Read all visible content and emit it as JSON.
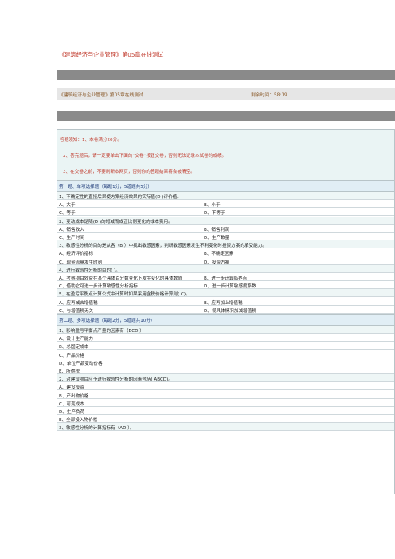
{
  "page_title": "《建筑经济与企业管理》第05章在线测试",
  "info": {
    "exam_name": "《建筑经济与企业管理》第05章在线测试",
    "timer": "剩余时间：58:19"
  },
  "notice": [
    "答题须知：1、本卷满分20分。",
    "2、答完题后，请一定要单击下面的“交卷”按钮交卷，否则无法记录本试卷的成绩。",
    "3、在交卷之前，不要刷新本网页，否则你的答题结果将会被清空。"
  ],
  "section1": {
    "heading": "第一题、单项选择题（每题1分，5道题共5分）",
    "questions": [
      {
        "stem": "1、不确定性的直接后果使方案经济效果的实际值(D )评价值。",
        "options": [
          [
            "A、大于",
            "B、小于"
          ],
          [
            "C、等于",
            "D、不等于"
          ]
        ]
      },
      {
        "stem": "2、变动成本是随(D )的增减而成正比例变化的成本费用。",
        "options": [
          [
            "A、销售收入",
            "B、销售利润"
          ],
          [
            "C、生产时间",
            "D、生产数量"
          ]
        ]
      },
      {
        "stem": "3、敏感性分析的目的是从各（B ）中找出敏感因素，判断敏感因素发生不利变化时投资方案的承受能力。",
        "options": [
          [
            "A、经济评价指标",
            "B、不确定因素"
          ],
          [
            "C、现金流量发生时刻",
            "D、投资方案"
          ]
        ]
      },
      {
        "stem": "4、进行敏感性分析的目的( )。",
        "options": [
          [
            "A、考察项目效益在某个具体百分数变化下发生变化的具体数值",
            "B、进一步计算临界点"
          ],
          [
            "C、借助它可进一步计算敏感性分析指标",
            "D、进一步计算敏感度系数"
          ]
        ]
      },
      {
        "stem": "5、在盈亏平衡点计算公式中计算时如果采用含税价格计算则( C)。",
        "options": [
          [
            "A、应再减去增值税",
            "B、应再加上增值税"
          ],
          [
            "C、与增值税无关",
            "D、视具体情况加减增值税"
          ]
        ]
      }
    ]
  },
  "section2": {
    "heading": "第二题、多项选择题（每题2分，5道题共10分）",
    "questions": [
      {
        "stem": "1、影响盈亏平衡点产量的因素有（BCD ）",
        "options": [
          "A、设计生产能力",
          "B、总固定成本",
          "C、产品价格",
          "D、单位产品变动价格",
          "E、所得税"
        ]
      },
      {
        "stem": "2、对建设项目应予进行敏感性分析的因素包括( ABCD)。",
        "options": [
          "A、建设投资",
          "B、产出物价格",
          "C、可变成本",
          "D、生产负荷",
          "E、全部投入物价格"
        ]
      },
      {
        "stem": "3、敏感性分析的计算指标有（AD ）。",
        "options": []
      }
    ]
  }
}
